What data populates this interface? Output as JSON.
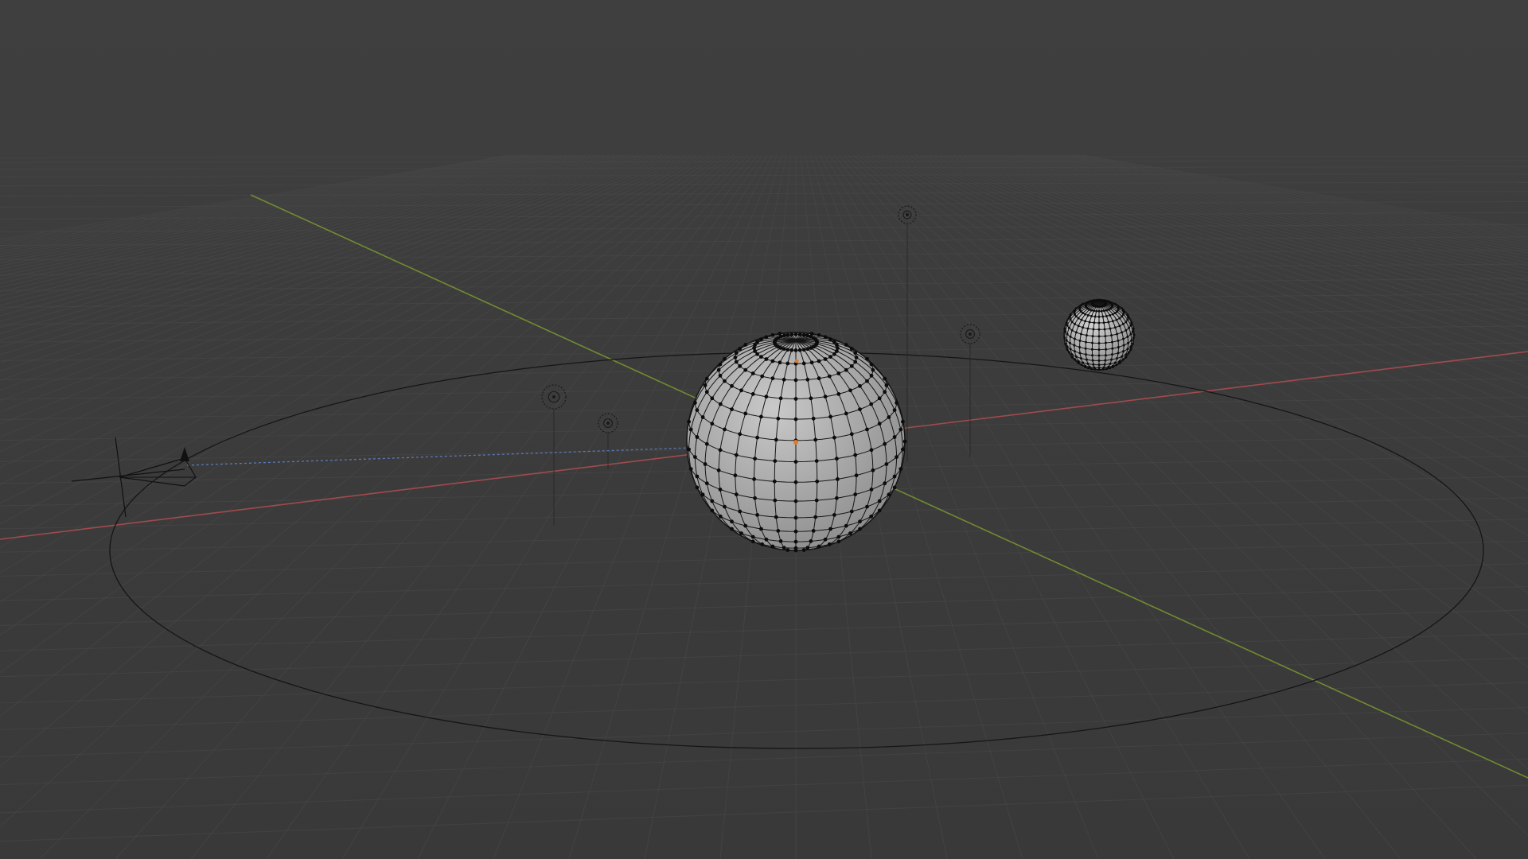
{
  "viewport": {
    "mode": "3d-viewport",
    "view": "perspective",
    "overlays": {
      "floor_grid": true,
      "x_axis": true,
      "y_axis": true
    },
    "colors": {
      "background": "#3d3d3d",
      "grid": "#4a4a4a",
      "x_axis": "#b34d52",
      "y_axis": "#7a9a2e",
      "wire": "#111111",
      "mesh_fill": "#a8a8a8",
      "origin": "#e07a2c",
      "camera_path": "#5a7ab8"
    }
  },
  "scene": {
    "objects": [
      {
        "name": "large-uv-sphere",
        "type": "mesh"
      },
      {
        "name": "small-uv-sphere",
        "type": "mesh"
      },
      {
        "name": "camera",
        "type": "camera"
      },
      {
        "name": "orbit-circle",
        "type": "curve"
      },
      {
        "name": "light-1",
        "type": "light"
      },
      {
        "name": "light-2",
        "type": "light"
      },
      {
        "name": "light-3",
        "type": "light"
      },
      {
        "name": "light-4",
        "type": "light"
      }
    ]
  }
}
